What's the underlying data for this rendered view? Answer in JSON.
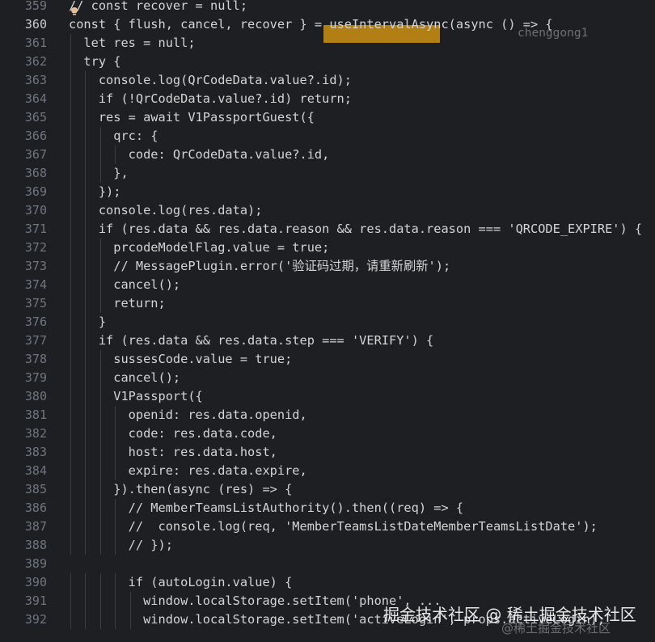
{
  "editor": {
    "first_line": 359,
    "active_line": 360,
    "blame": "chenggong1",
    "lines": [
      "// const recover = null;",
      "const { flush, cancel, recover } = useIntervalAsync(async () => {",
      "  let res = null;",
      "  try {",
      "    console.log(QrCodeData.value?.id);",
      "    if (!QrCodeData.value?.id) return;",
      "    res = await V1PassportGuest({",
      "      qrc: {",
      "        code: QrCodeData.value?.id,",
      "      },",
      "    });",
      "    console.log(res.data);",
      "    if (res.data && res.data.reason && res.data.reason === 'QRCODE_EXPIRE') {",
      "      prcodeModelFlag.value = true;",
      "      // MessagePlugin.error('验证码过期，请重新刷新');",
      "      cancel();",
      "      return;",
      "    }",
      "    if (res.data && res.data.step === 'VERIFY') {",
      "      sussesCode.value = true;",
      "      cancel();",
      "      V1Passport({",
      "        openid: res.data.openid,",
      "        code: res.data.code,",
      "        host: res.data.host,",
      "        expire: res.data.expire,",
      "      }).then(async (res) => {",
      "        // MemberTeamsListAuthority().then((req) => {",
      "        //  console.log(req, 'MemberTeamsListDateMemberTeamsListDate');",
      "        // });",
      "",
      "        if (autoLogin.value) {",
      "          window.localStorage.setItem('phone', ...",
      "          window.localStorage.setItem('activeLogin', props.activeLogin);"
    ]
  },
  "watermark": {
    "text": "掘金技术社区 @ 稀土掘金技术社区",
    "ghost_text": "@稀土掘金技术社区"
  }
}
